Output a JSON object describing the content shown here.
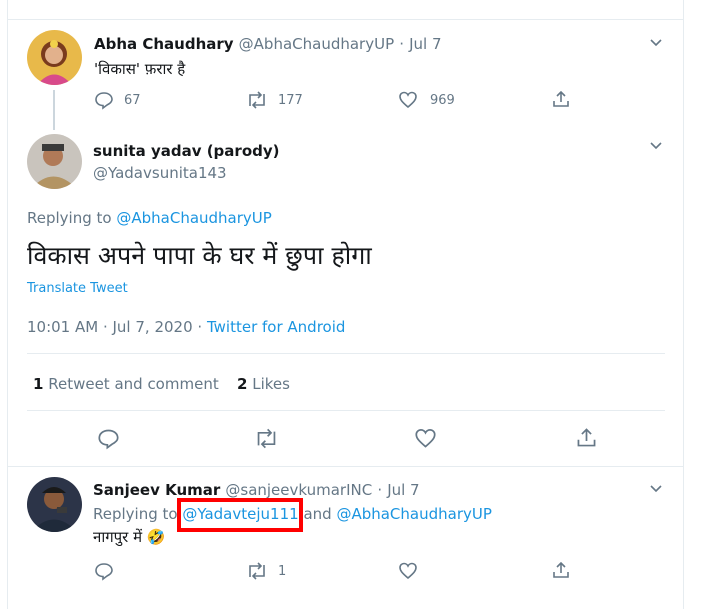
{
  "tweet1": {
    "name": "Abha Chaudhary",
    "handle": "@AbhaChaudharyUP",
    "sep": "·",
    "date": "Jul 7",
    "text": "'विकास' फ़रार है",
    "replies": "67",
    "retweets": "177",
    "likes": "969"
  },
  "main_tweet": {
    "name": "sunita yadav (parody)",
    "handle": "@Yadavsunita143",
    "replying_to_label": "Replying to",
    "replying_to_handle": "@AbhaChaudharyUP",
    "text": "विकास अपने पापा के घर में छुपा होगा",
    "translate": "Translate Tweet",
    "timestamp": "10:01 AM · Jul 7, 2020",
    "sep": "·",
    "source": "Twitter for Android",
    "retweet_count": "1",
    "retweet_label": "Retweet and comment",
    "like_count": "2",
    "like_label": "Likes"
  },
  "reply": {
    "name": "Sanjeev Kumar",
    "handle": "@sanjeevkumarINC",
    "sep": "·",
    "date": "Jul 7",
    "replying_to_label": "Replying to",
    "mention1": "@Yadavteju111",
    "and_label": "and",
    "mention2": "@AbhaChaudharyUP",
    "text": "नागपुर में 🤣",
    "retweets": "1"
  },
  "colors": {
    "link": "#1b95e0",
    "muted": "#657786",
    "border": "#e6ecf0",
    "highlight": "#ff0000"
  }
}
